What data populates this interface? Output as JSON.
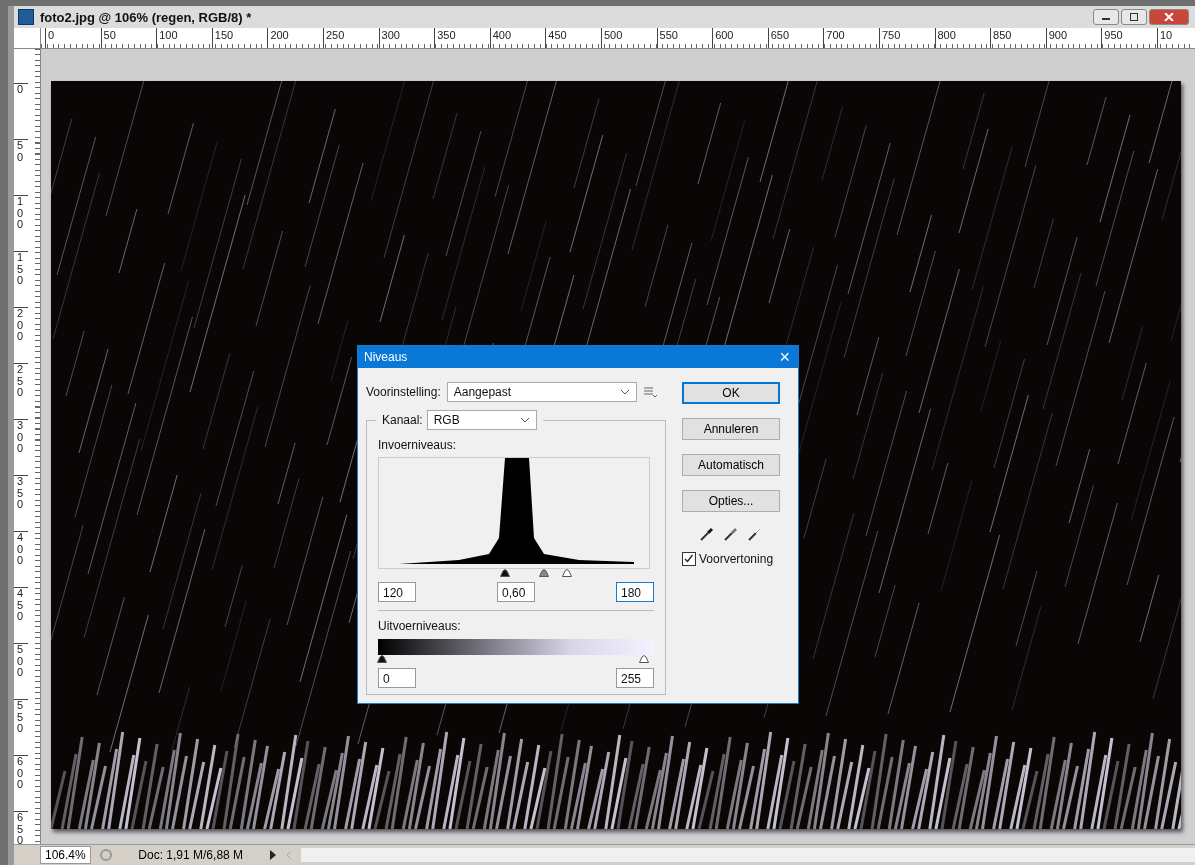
{
  "document_window": {
    "title": "foto2.jpg @ 106% (regen, RGB/8) *"
  },
  "top_ruler": {
    "labels": [
      "0",
      "50",
      "100",
      "150",
      "200",
      "250",
      "300",
      "350",
      "400",
      "450",
      "500",
      "550",
      "600",
      "650",
      "700",
      "750",
      "800",
      "850",
      "900",
      "950",
      "10"
    ]
  },
  "left_ruler": {
    "labels": [
      "0",
      "50",
      "100",
      "150",
      "200",
      "250",
      "300",
      "350",
      "400",
      "450",
      "500",
      "550",
      "600",
      "650"
    ]
  },
  "dialog": {
    "title": "Niveaus",
    "close": "×",
    "preset": {
      "label": "Voorinstelling:",
      "value": "Aangepast"
    },
    "channel": {
      "label": "Kanaal:",
      "value": "RGB"
    },
    "input_label": "Invoerniveaus:",
    "input_sliders": [
      {
        "kind": "black",
        "level": 0.47
      },
      {
        "kind": "gray",
        "level": 0.62
      },
      {
        "kind": "white",
        "level": 0.706
      }
    ],
    "input_fields": [
      {
        "value": "120",
        "focused": false
      },
      {
        "value": "0,60",
        "focused": false
      },
      {
        "value": "180",
        "focused": true
      }
    ],
    "output_label": "Uitvoerniveaus:",
    "output_sliders": [
      {
        "kind": "black",
        "level": 0
      },
      {
        "kind": "white",
        "level": 1
      }
    ],
    "output_fields": [
      {
        "value": "0",
        "focused": false
      },
      {
        "value": "255",
        "focused": false
      }
    ],
    "buttons": [
      {
        "label": "OK",
        "default": true
      },
      {
        "label": "Annuleren",
        "default": false
      },
      {
        "label": "Automatisch",
        "default": false
      },
      {
        "label": "Opties...",
        "default": false
      }
    ],
    "eyedroppers": [
      {
        "kind": "black"
      },
      {
        "kind": "gray"
      },
      {
        "kind": "white"
      }
    ],
    "preview": {
      "label": "Voorvertoning",
      "checked": true
    }
  },
  "status_bar": {
    "zoom": "106.4%",
    "doc": "Doc: 1,91 M/6,88 M"
  }
}
